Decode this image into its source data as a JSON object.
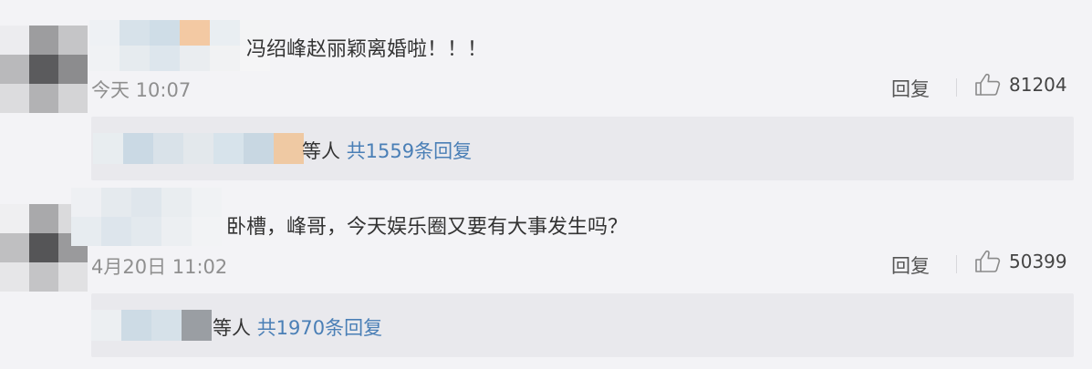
{
  "colors": {
    "background": "#f3f3f6",
    "reply_box": "#e9e9ed",
    "link": "#4a7fb6",
    "muted": "#8f8f8f",
    "text": "#333333"
  },
  "comments": [
    {
      "text": "冯绍峰赵丽颖离婚啦！！！",
      "timestamp": "今天 10:07",
      "reply_label": "回复",
      "like_icon": "thumbs-up-icon",
      "like_count": "81204",
      "reply_suffix": "等人",
      "reply_link": "共1559条回复",
      "avatar_pixels": [
        "#ececef",
        "#9d9d9f",
        "#c5c5c7",
        "#b9b9bb",
        "#5b5b5d",
        "#8c8c8e",
        "#dcdcde",
        "#b2b2b4",
        "#d4d4d6"
      ],
      "name_pixels": [
        "#eef1f4",
        "#d7e2ea",
        "#cfdde7",
        "#f3c9a3",
        "#e9eef2",
        "#f3f4f5",
        "#f0f2f4",
        "#e6ebef",
        "#dde6ed",
        "#eaedf0",
        "#f1f2f3",
        "#f5f5f6"
      ],
      "reply_pixels": [
        "#e8edf0",
        "#cad9e4",
        "#d9e2e9",
        "#e3e8ec",
        "#d7e3eb",
        "#c8d7e2",
        "#efc9a3"
      ]
    },
    {
      "text": "卧槽，峰哥，今天娱乐圈又要有大事发生吗？",
      "timestamp": "4月20日 11:02",
      "reply_label": "回复",
      "like_icon": "thumbs-up-icon",
      "like_count": "50399",
      "reply_suffix": "等人",
      "reply_link": "共1970条回复",
      "avatar_pixels": [
        "#efeff1",
        "#a9a9ab",
        "#dadadc",
        "#bfbfc1",
        "#555557",
        "#9a9a9c",
        "#e6e6e8",
        "#c4c4c6",
        "#e1e1e3"
      ],
      "name_pixels": [
        "#eef0f3",
        "#e5eaee",
        "#dfe6ec",
        "#e9edf0",
        "#f0f2f4",
        "#e7ecf0",
        "#dde5ec",
        "#e3e9ee",
        "#eceff2",
        "#f2f3f5"
      ],
      "reply_pixels": [
        "#eceff2",
        "#cddbe5",
        "#d6e1e9",
        "#9a9ea3"
      ]
    }
  ]
}
